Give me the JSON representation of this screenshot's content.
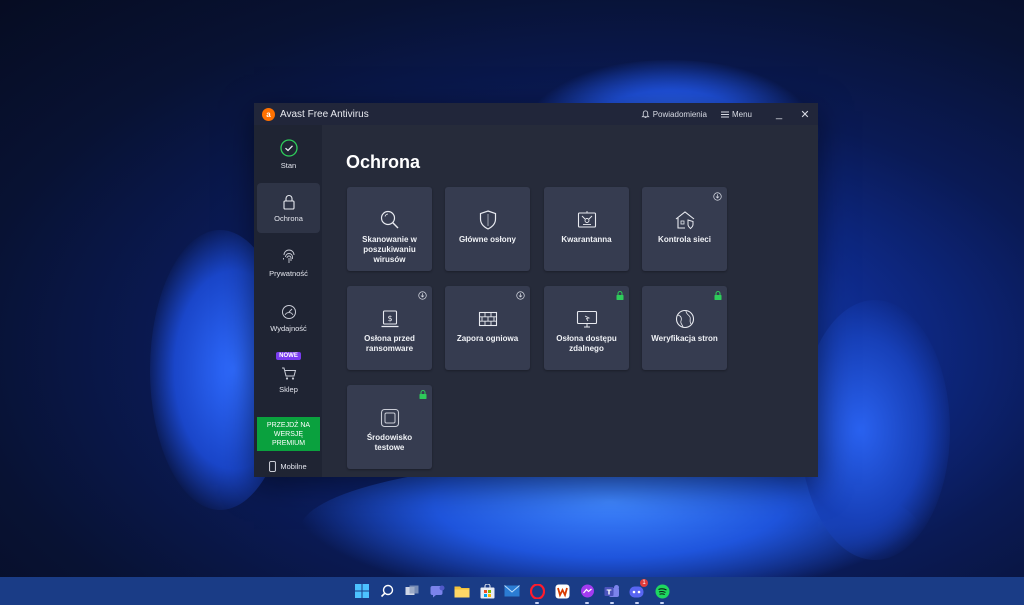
{
  "window": {
    "title": "Avast Free Antivirus",
    "notifications_label": "Powiadomienia",
    "menu_label": "Menu",
    "minimize": "_",
    "close": "✕"
  },
  "sidebar": {
    "items": [
      {
        "label": "Stan",
        "icon": "check-circle-icon"
      },
      {
        "label": "Ochrona",
        "icon": "lock-icon",
        "active": true
      },
      {
        "label": "Prywatność",
        "icon": "fingerprint-icon"
      },
      {
        "label": "Wydajność",
        "icon": "gauge-icon"
      },
      {
        "label": "Sklep",
        "icon": "cart-icon",
        "badge": "NOWE"
      }
    ],
    "premium_label": "PRZEJDŹ NA WERSJĘ PREMIUM",
    "mobile_label": "Mobilne"
  },
  "main": {
    "heading": "Ochrona",
    "tiles": [
      {
        "label": "Skanowanie w poszukiwaniu wirusów",
        "icon": "magnifier-icon"
      },
      {
        "label": "Główne osłony",
        "icon": "shield-icon"
      },
      {
        "label": "Kwarantanna",
        "icon": "quarantine-icon"
      },
      {
        "label": "Kontrola sieci",
        "icon": "home-network-icon",
        "corner": "download-icon"
      },
      {
        "label": "Osłona przed ransomware",
        "icon": "ransomware-icon",
        "corner": "download-icon"
      },
      {
        "label": "Zapora ogniowa",
        "icon": "firewall-icon",
        "corner": "download-icon"
      },
      {
        "label": "Osłona dostępu zdalnego",
        "icon": "remote-desktop-icon",
        "corner": "lock-icon"
      },
      {
        "label": "Weryfikacja stron",
        "icon": "globe-icon",
        "corner": "lock-icon"
      },
      {
        "label": "Środowisko testowe",
        "icon": "sandbox-icon",
        "corner": "lock-icon"
      }
    ]
  },
  "taskbar": {
    "icons": [
      "windows-start-icon",
      "search-icon",
      "task-view-icon",
      "chat-icon",
      "file-explorer-icon",
      "store-icon",
      "mail-icon",
      "opera-icon",
      "office-icon",
      "messenger-icon",
      "teams-icon",
      "discord-icon",
      "spotify-icon"
    ],
    "discord_badge": "1"
  },
  "colors": {
    "accent_green": "#0aa13e",
    "avast_orange": "#ff7100",
    "badge_purple": "#7a3cf0",
    "lock_green": "#2ecc5a"
  }
}
